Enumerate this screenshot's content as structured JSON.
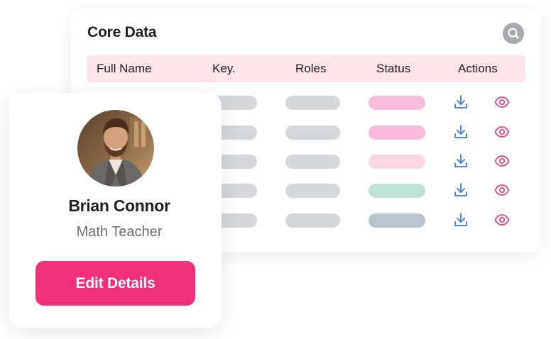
{
  "table": {
    "title": "Core Data",
    "columns": [
      "Full Name",
      "Key.",
      "Roles",
      "Status",
      "Actions"
    ],
    "rows": [
      {
        "status_color": "#f8bddc",
        "download_icon": "download-icon",
        "view_icon": "eye-icon"
      },
      {
        "status_color": "#f8bddc",
        "download_icon": "download-icon",
        "view_icon": "eye-icon"
      },
      {
        "status_color": "#fbd7e3",
        "download_icon": "download-icon",
        "view_icon": "eye-icon"
      },
      {
        "status_color": "#bfe1d6",
        "download_icon": "download-icon",
        "view_icon": "eye-icon"
      },
      {
        "status_color": "#b8c4ce",
        "download_icon": "download-icon",
        "view_icon": "eye-icon"
      }
    ],
    "search_icon": "search-icon"
  },
  "profile": {
    "name": "Brian Connor",
    "role": "Math Teacher",
    "edit_label": "Edit Details",
    "avatar_icon": "avatar"
  },
  "colors": {
    "accent": "#f0317a",
    "header_bg": "#fde3ea",
    "placeholder_pill": "#d6d7db",
    "download_icon": "#3c7be0",
    "view_icon": "#e8487f"
  }
}
